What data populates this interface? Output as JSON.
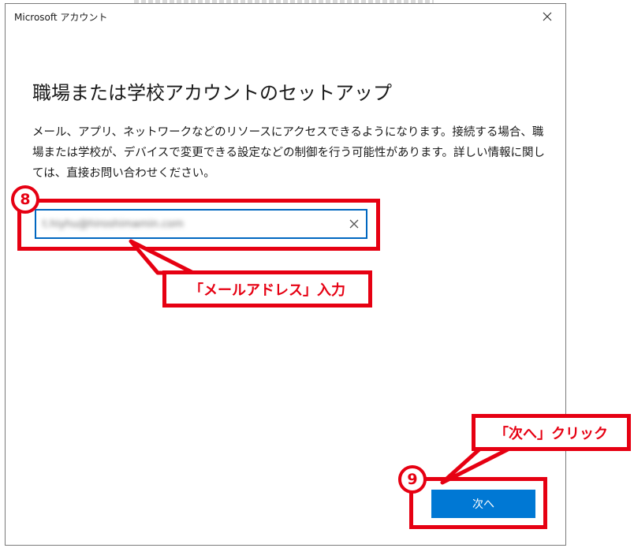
{
  "window": {
    "title": "Microsoft アカウント"
  },
  "dialog": {
    "heading": "職場または学校アカウントのセットアップ",
    "description": "メール、アプリ、ネットワークなどのリソースにアクセスできるようになります。接続する場合、職場または学校が、デバイスで変更できる設定などの制御を行う可能性があります。詳しい情報に関しては、直接お問い合わせください。",
    "email_value": "t.hiyhu@hiroshimamin.com",
    "next_label": "次へ"
  },
  "annotations": {
    "step8_number": "8",
    "step8_caption": "「メールアドレス」入力",
    "step9_number": "9",
    "step9_caption": "「次へ」クリック",
    "accent_color": "#e60012"
  },
  "icons": {
    "close": "close-icon",
    "clear": "clear-icon"
  },
  "colors": {
    "button_blue": "#0078d4",
    "input_focus_border": "#0067c0"
  }
}
